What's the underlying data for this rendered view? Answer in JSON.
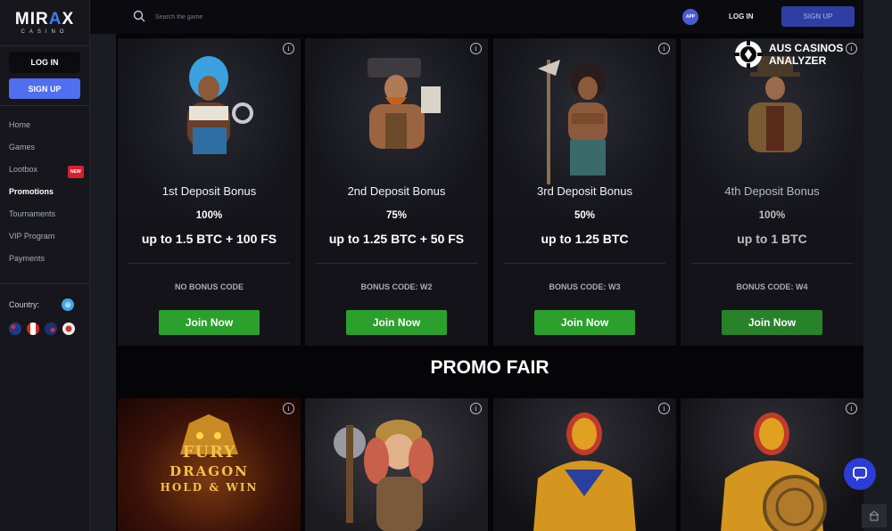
{
  "brand": {
    "name_a": "MIR",
    "name_x": "A",
    "name_b": "X",
    "sub": "CASINO"
  },
  "sidebar": {
    "login_label": "LOG IN",
    "signup_label": "SIGN UP",
    "items": [
      {
        "label": "Home"
      },
      {
        "label": "Games"
      },
      {
        "label": "Lootbox",
        "badge": "NEW"
      },
      {
        "label": "Promotions",
        "active": true
      },
      {
        "label": "Tournaments"
      },
      {
        "label": "VIP Program"
      },
      {
        "label": "Payments"
      }
    ],
    "country_label": "Country:",
    "flags": [
      "au-flag-icon",
      "ca-flag-icon",
      "nz-flag-icon",
      "other-flag-icon"
    ]
  },
  "topbar": {
    "search_placeholder": "Search the game",
    "app_label": "APP",
    "login_label": "LOG IN",
    "signup_label": "SIGN UP"
  },
  "bonuses": [
    {
      "title": "1st Deposit Bonus",
      "percent": "100%",
      "offer": "up to 1.5 BTC + 100 FS",
      "code": "NO BONUS CODE",
      "cta": "Join Now"
    },
    {
      "title": "2nd Deposit Bonus",
      "percent": "75%",
      "offer": "up to 1.25 BTC + 50 FS",
      "code": "BONUS CODE: W2",
      "cta": "Join Now"
    },
    {
      "title": "3rd Deposit Bonus",
      "percent": "50%",
      "offer": "up to 1.25 BTC",
      "code": "BONUS CODE: W3",
      "cta": "Join Now"
    },
    {
      "title": "4th Deposit Bonus",
      "percent": "100%",
      "offer": "up to 1 BTC",
      "code": "BONUS CODE: W4",
      "cta": "Join Now"
    }
  ],
  "promo_heading": "PROMO FAIR",
  "promo_games": [
    {
      "line1": "FURY",
      "line2": "DRAGON",
      "line3": "HOLD & WIN"
    },
    {
      "line1": "",
      "line2": "",
      "line3": ""
    },
    {
      "line1": "",
      "line2": "",
      "line3": ""
    },
    {
      "line1": "",
      "line2": "",
      "line3": ""
    }
  ],
  "watermark": {
    "line1": "AUS CASINOS",
    "line2": "ANALYZER"
  },
  "colors": {
    "accent": "#4f6ef0",
    "join": "#2ca02c",
    "background": "#050507"
  }
}
